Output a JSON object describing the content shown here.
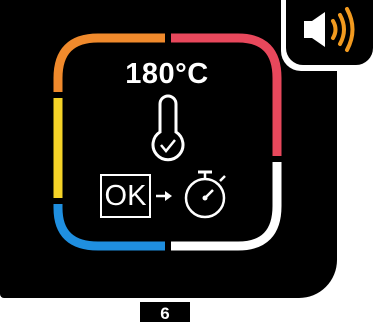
{
  "display": {
    "temperature": "180°C",
    "ok_label": "OK",
    "step_number": "6"
  },
  "icons": {
    "sound": "speaker-icon",
    "thermometer": "thermometer-check-icon",
    "arrow": "arrow-right-icon",
    "timer": "timer-icon"
  },
  "colors": {
    "orange": "#f08a2c",
    "red": "#e8485c",
    "yellow": "#f5d327",
    "blue": "#1f8fe0",
    "white": "#ffffff",
    "sound_waves": "#f29a1f"
  }
}
